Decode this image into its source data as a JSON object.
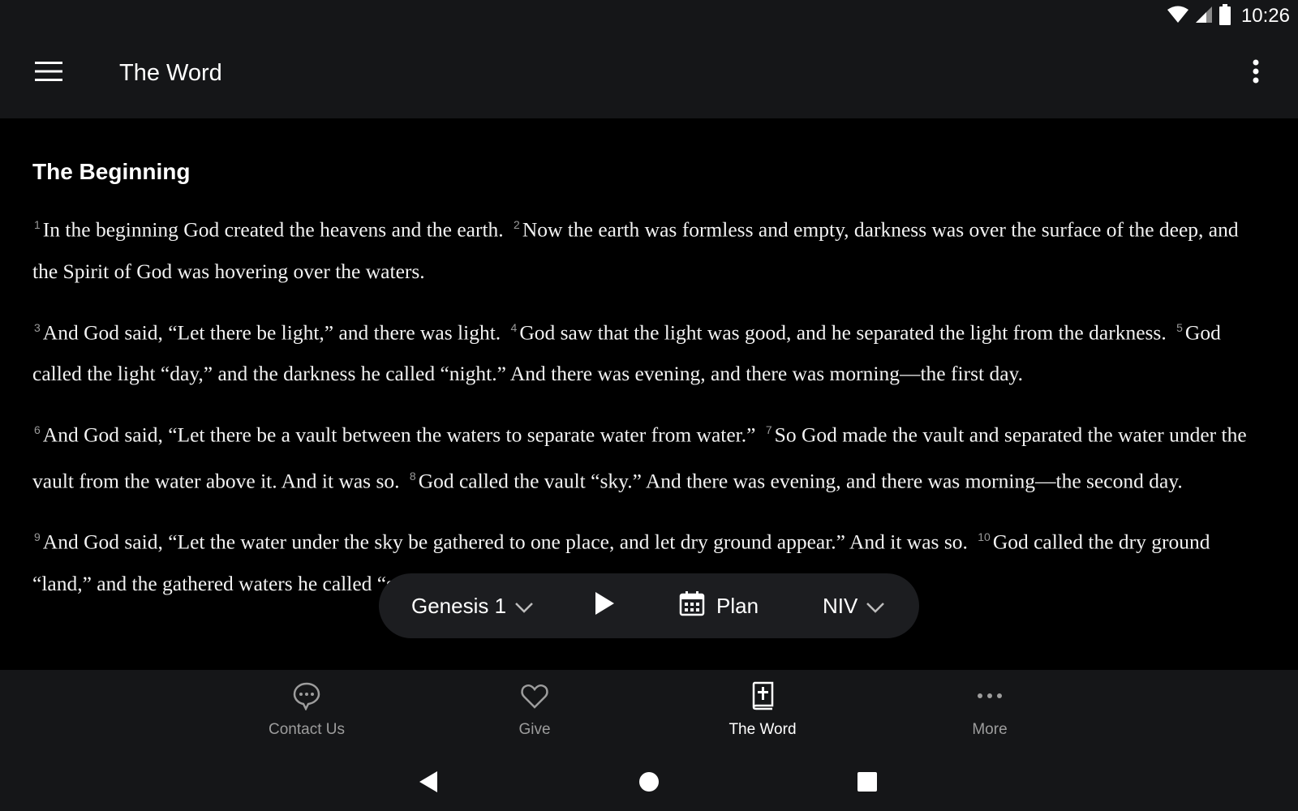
{
  "status_bar": {
    "time": "10:26",
    "icons": [
      "wifi-icon",
      "cellular-signal-icon",
      "battery-icon"
    ]
  },
  "app_bar": {
    "title": "The Word",
    "menu_icon": "hamburger-menu-icon",
    "overflow_icon": "more-vertical-icon"
  },
  "content": {
    "heading": "The Beginning",
    "paragraphs": [
      [
        {
          "num": "1",
          "text": "In the beginning God created the heavens and the earth."
        },
        {
          "num": "2",
          "text": "Now the earth was formless and empty, darkness was over the surface of the deep, and the Spirit of God was hovering over the waters."
        }
      ],
      [
        {
          "num": "3",
          "text": "And God said, “Let there be light,” and there was light."
        },
        {
          "num": "4",
          "text": "God saw that the light was good, and he separated the light from the darkness."
        },
        {
          "num": "5",
          "text": "God called the light “day,” and the darkness he called “night.” And there was evening, and there was morning—the first day."
        }
      ],
      [
        {
          "num": "6",
          "text": "And God said, “Let there be a vault between the waters to separate water from water.”"
        },
        {
          "num": "7",
          "text": "So God made the vault and separated the water under the vault from the water above it. And it was so."
        },
        {
          "num": "8",
          "text": "God called the vault “sky.” And there was evening, and there was morning—the second day."
        }
      ],
      [
        {
          "num": "9",
          "text": "And God said, “Let the water under the sky be gathered to one place, and let dry ground appear.” And it was so."
        },
        {
          "num": "10",
          "text": "God called the dry ground “land,” and the gathered waters he called “seas.” And God saw that it was good."
        }
      ]
    ]
  },
  "reader_toolbar": {
    "book_chapter": "Genesis 1",
    "play_icon": "play-icon",
    "plan_label": "Plan",
    "plan_icon": "calendar-icon",
    "version": "NIV"
  },
  "bottom_nav": {
    "items": [
      {
        "label": "Contact Us",
        "icon": "chat-bubble-icon",
        "active": false
      },
      {
        "label": "Give",
        "icon": "heart-icon",
        "active": false
      },
      {
        "label": "The Word",
        "icon": "bible-icon",
        "active": true
      },
      {
        "label": "More",
        "icon": "more-horizontal-icon",
        "active": false
      }
    ]
  },
  "system_nav": {
    "icons": [
      "back-icon",
      "home-icon",
      "recents-icon"
    ]
  },
  "colors": {
    "background": "#000000",
    "bar_background": "#151618",
    "toolbar_background": "#1c1d20",
    "text_primary": "#ffffff",
    "text_inactive": "#9d9d9d",
    "verse_number": "#9a9a9a"
  }
}
